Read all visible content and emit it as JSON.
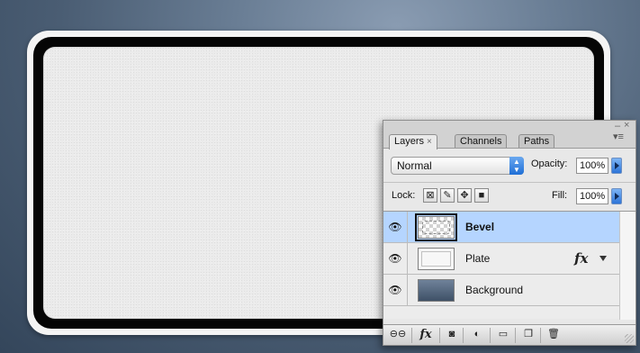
{
  "canvas": {
    "layers_shown": [
      "Bevel",
      "Plate",
      "Background"
    ]
  },
  "panel": {
    "tabs": [
      {
        "label": "Layers",
        "close": "×",
        "active": true
      },
      {
        "label": "Channels",
        "active": false
      },
      {
        "label": "Paths",
        "active": false
      }
    ],
    "window_controls": {
      "minimize": "–",
      "close": "×",
      "menu": "▾≡"
    },
    "blend_mode": "Normal",
    "opacity_label": "Opacity:",
    "opacity_value": "100%",
    "lock_label": "Lock:",
    "fill_label": "Fill:",
    "fill_value": "100%",
    "lock_icons": [
      "lock-transparent-pixels-icon",
      "lock-image-pixels-icon",
      "lock-position-icon",
      "lock-all-icon"
    ],
    "layers": [
      {
        "name": "Bevel",
        "selected": true,
        "visible": true,
        "has_fx": false
      },
      {
        "name": "Plate",
        "selected": false,
        "visible": true,
        "has_fx": true,
        "fx_label": "fx"
      },
      {
        "name": "Background",
        "selected": false,
        "visible": true,
        "has_fx": false
      }
    ],
    "bottom_buttons": [
      {
        "icon": "link-layers-icon"
      },
      {
        "icon": "add-layer-style-icon",
        "label": "fx"
      },
      {
        "icon": "add-mask-icon"
      },
      {
        "icon": "adjustment-layer-icon"
      },
      {
        "icon": "new-group-icon"
      },
      {
        "icon": "new-layer-icon"
      },
      {
        "icon": "trash-icon"
      }
    ]
  },
  "colors": {
    "selection": "#b5d5ff",
    "accent_blue": "#2d74d8",
    "background_top": "#8a9cb2",
    "background_bottom": "#34465b"
  }
}
